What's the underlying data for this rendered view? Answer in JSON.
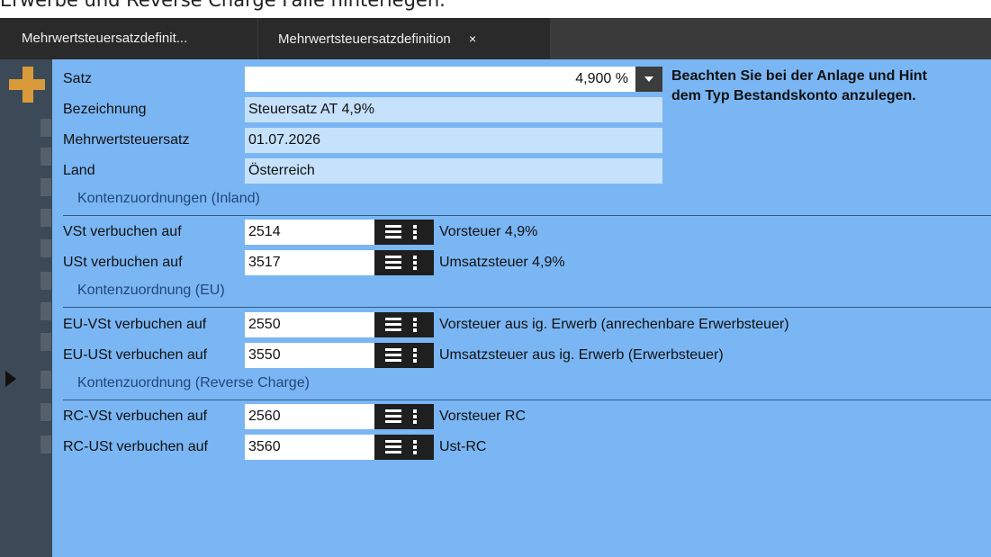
{
  "top_text": "Erwerbe und Reverse Charge Fälle hinterlegen.",
  "tabs": [
    {
      "label": "Mehrwertsteuersatzdefinit..."
    },
    {
      "label": "Mehrwertsteuersatzdefinition",
      "close": "×"
    }
  ],
  "form": {
    "satz": {
      "label": "Satz",
      "value": "4,900 %"
    },
    "bezeichnung": {
      "label": "Bezeichnung",
      "value": "Steuersatz AT 4,9%"
    },
    "mwst": {
      "label": "Mehrwertsteuersatz",
      "value": "01.07.2026"
    },
    "land": {
      "label": "Land",
      "value": "Österreich"
    }
  },
  "hint": {
    "line1": "Beachten Sie bei der Anlage und Hint",
    "line2": "dem Typ Bestandskonto anzulegen."
  },
  "sections": {
    "inland": "Kontenzuordnungen (Inland)",
    "eu": "Kontenzuordnung (EU)",
    "rc": "Kontenzuordnung (Reverse Charge)"
  },
  "accounts": [
    {
      "label": "VSt verbuchen auf",
      "value": "2514",
      "desc": "Vorsteuer 4,9%"
    },
    {
      "label": "USt verbuchen auf",
      "value": "3517",
      "desc": "Umsatzsteuer 4,9%"
    },
    {
      "label": "EU-VSt verbuchen auf",
      "value": "2550",
      "desc": "Vorsteuer aus ig. Erwerb (anrechenbare Erwerbsteuer)"
    },
    {
      "label": "EU-USt verbuchen auf",
      "value": "3550",
      "desc": "Umsatzsteuer aus ig. Erwerb (Erwerbsteuer)"
    },
    {
      "label": "RC-VSt verbuchen auf",
      "value": "2560",
      "desc": "Vorsteuer RC"
    },
    {
      "label": "RC-USt verbuchen auf",
      "value": "3560",
      "desc": "Ust-RC"
    }
  ],
  "icons": {
    "add": "plus-icon",
    "list": "list-icon",
    "more": "more-vertical-icon",
    "dropdown": "dropdown-arrow-icon",
    "close": "close-icon",
    "row_pointer": "row-pointer-icon"
  },
  "colors": {
    "panel_bg": "#7ab6f4",
    "field_bg": "#c5e1fb",
    "section_text": "#22477a",
    "tab_bg": "#2a2a2a",
    "accent_add": "#d89a3a"
  }
}
